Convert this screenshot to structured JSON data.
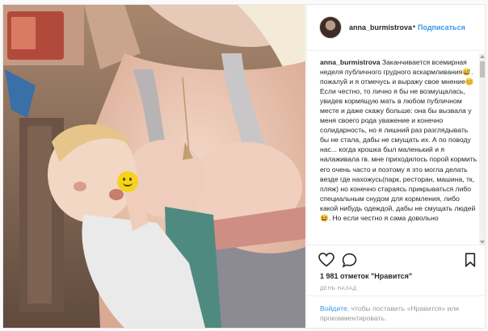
{
  "author": {
    "username": "anna_burmistrova",
    "follow_label": "Подписаться",
    "separator": "•"
  },
  "caption": {
    "username": "anna_burmistrova",
    "text": "Заканчивается всемирная неделя публичного грудного вскармливания😅. пожалуй и я отмечусь и выражу свое мнение😊 Если честно, то лично я бы не возмущалась, увидев кормящую мать в любом публичном месте и даже скажу больше: она бы вызвала у меня своего рода уважение и конечно солидарность, но я лишний раз разглядывать бы не стала, дабы не смущать их. А по поводу нас... когда крошка был маленький и я налаживала гв. мне приходилось порой кормить его очень часто и поэтому я это могла делать везде где нахожусь(парк, ресторан, машина, тк, пляж) но конечно стараясь прикрываться либо специальным снудом для кормления, либо какой нибудь одеждой, дабы не смущать людей😆. Но если честно я сама довольно"
  },
  "icons": {
    "like": "heart-icon",
    "comment": "comment-bubble-icon",
    "save": "bookmark-icon",
    "avatar": "avatar",
    "sticker": "smiley-emoji-sticker"
  },
  "likes_text": "1 981 отметок \"Нравится\"",
  "timestamp": "ДЕНЬ НАЗАД",
  "footer": {
    "login_link": "Войдите",
    "text": ", чтобы поставить «Нравится» или прокомментировать."
  }
}
